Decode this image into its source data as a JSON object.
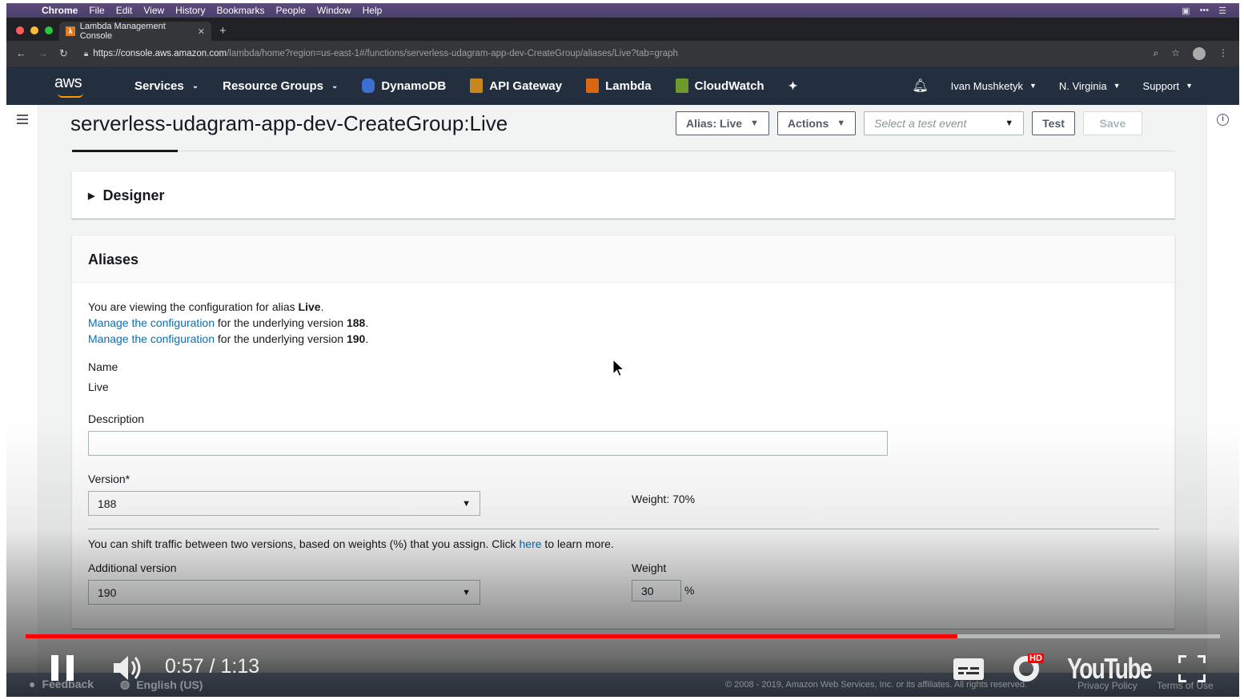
{
  "menubar": {
    "app": "Chrome",
    "items": [
      "File",
      "Edit",
      "View",
      "History",
      "Bookmarks",
      "People",
      "Window",
      "Help"
    ]
  },
  "browser": {
    "tab_title": "Lambda Management Console",
    "url_host": "https://console.aws.amazon.com",
    "url_path": "/lambda/home?region=us-east-1#/functions/serverless-udagram-app-dev-CreateGroup/aliases/Live?tab=graph"
  },
  "aws_nav": {
    "logo": "aws",
    "services": "Services",
    "resource_groups": "Resource Groups",
    "shortcuts": [
      "DynamoDB",
      "API Gateway",
      "Lambda",
      "CloudWatch"
    ],
    "user": "Ivan Mushketyk",
    "region": "N. Virginia",
    "support": "Support"
  },
  "page": {
    "title": "serverless-udagram-app-dev-CreateGroup:Live",
    "alias_button": "Alias: Live",
    "actions_button": "Actions",
    "test_event_placeholder": "Select a test event",
    "test_button": "Test",
    "save_button": "Save"
  },
  "designer": {
    "title": "Designer"
  },
  "aliases": {
    "title": "Aliases",
    "viewing_prefix": "You are viewing the configuration for alias ",
    "viewing_alias": "Live",
    "manage_link": "Manage the configuration",
    "manage_suffix": " for the underlying version ",
    "version_a": "188",
    "version_b": "190",
    "name_label": "Name",
    "name_value": "Live",
    "description_label": "Description",
    "description_value": "",
    "version_label": "Version*",
    "version_value": "188",
    "weight_text": "Weight: 70%",
    "shift_text_prefix": "You can shift traffic between two versions, based on weights (%) that you assign. Click ",
    "shift_link": "here",
    "shift_text_suffix": " to learn more.",
    "additional_label": "Additional version",
    "additional_value": "190",
    "weight_label": "Weight",
    "weight_value": "30",
    "percent": "%"
  },
  "video": {
    "time": "0:57 / 1:13",
    "progress": 0.78,
    "hd_badge": "HD",
    "logo": "YouTube"
  },
  "footer": {
    "feedback": "Feedback",
    "language": "English (US)",
    "copyright": "© 2008 - 2019, Amazon Web Services, Inc. or its affiliates. All rights reserved.",
    "privacy": "Privacy Policy",
    "terms": "Terms of Use"
  },
  "colors": {
    "aws_nav_bg": "#232f3e",
    "link": "#0073bb",
    "progress_red": "#ff0000"
  }
}
